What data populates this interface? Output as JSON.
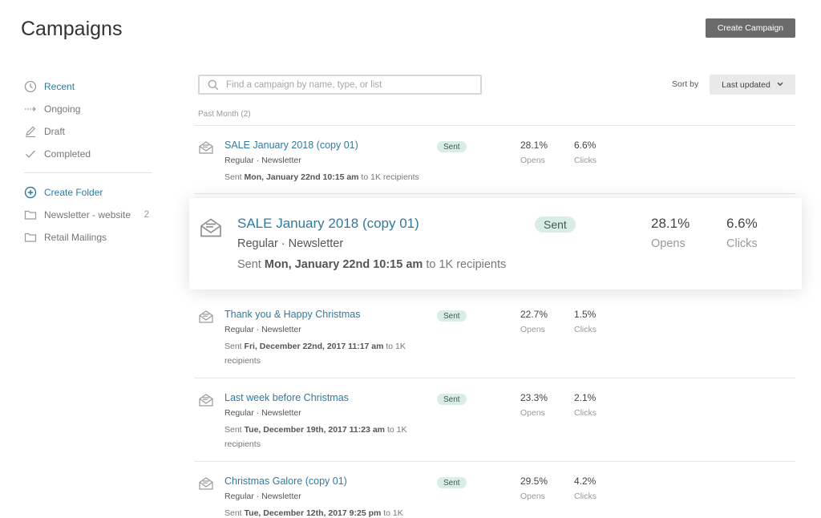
{
  "header": {
    "title": "Campaigns",
    "create_button": "Create Campaign"
  },
  "sidebar": {
    "nav": [
      {
        "label": "Recent",
        "icon": "clock-icon"
      },
      {
        "label": "Ongoing",
        "icon": "dashed-arrow-icon"
      },
      {
        "label": "Draft",
        "icon": "pencil-icon"
      },
      {
        "label": "Completed",
        "icon": "checkmark-icon"
      }
    ],
    "create_folder": "Create Folder",
    "folders": [
      {
        "label": "Newsletter - website",
        "count": "2"
      },
      {
        "label": "Retail Mailings"
      }
    ]
  },
  "search": {
    "placeholder": "Find a campaign by name, type, or list"
  },
  "sort": {
    "label": "Sort by",
    "value": "Last updated"
  },
  "section_label": "Past Month (2)",
  "campaigns": [
    {
      "title": "SALE January 2018 (copy 01)",
      "type": "Regular · Newsletter",
      "sent_prefix": "Sent ",
      "sent_date": "Mon, January 22nd 10:15 am",
      "sent_suffix": " to 1K recipients",
      "status": "Sent",
      "opens": "28.1%",
      "opens_label": "Opens",
      "clicks": "6.6%",
      "clicks_label": "Clicks"
    },
    {
      "title": "Thank you & Happy Christmas",
      "type": "Regular · Newsletter",
      "sent_prefix": "Sent ",
      "sent_date": "Fri, December 22nd, 2017 11:17 am",
      "sent_suffix": " to 1K recipients",
      "status": "Sent",
      "opens": "22.7%",
      "opens_label": "Opens",
      "clicks": "1.5%",
      "clicks_label": "Clicks"
    },
    {
      "title": "Last week before Christmas",
      "type": "Regular · Newsletter",
      "sent_prefix": "Sent ",
      "sent_date": "Tue, December 19th, 2017 11:23 am",
      "sent_suffix": " to 1K recipients",
      "status": "Sent",
      "opens": "23.3%",
      "opens_label": "Opens",
      "clicks": "2.1%",
      "clicks_label": "Clicks"
    },
    {
      "title": "Christmas Galore (copy 01)",
      "type": "Regular · Newsletter",
      "sent_prefix": "Sent ",
      "sent_date": "Tue, December 12th, 2017 9:25 pm",
      "sent_suffix": " to 1K",
      "status": "Sent",
      "opens": "29.5%",
      "opens_label": "Opens",
      "clicks": "4.2%",
      "clicks_label": "Clicks"
    }
  ],
  "colors": {
    "accent": "#2f7aa1",
    "badge_bg": "#d9ece6",
    "button_bg": "#6b6b6b"
  }
}
